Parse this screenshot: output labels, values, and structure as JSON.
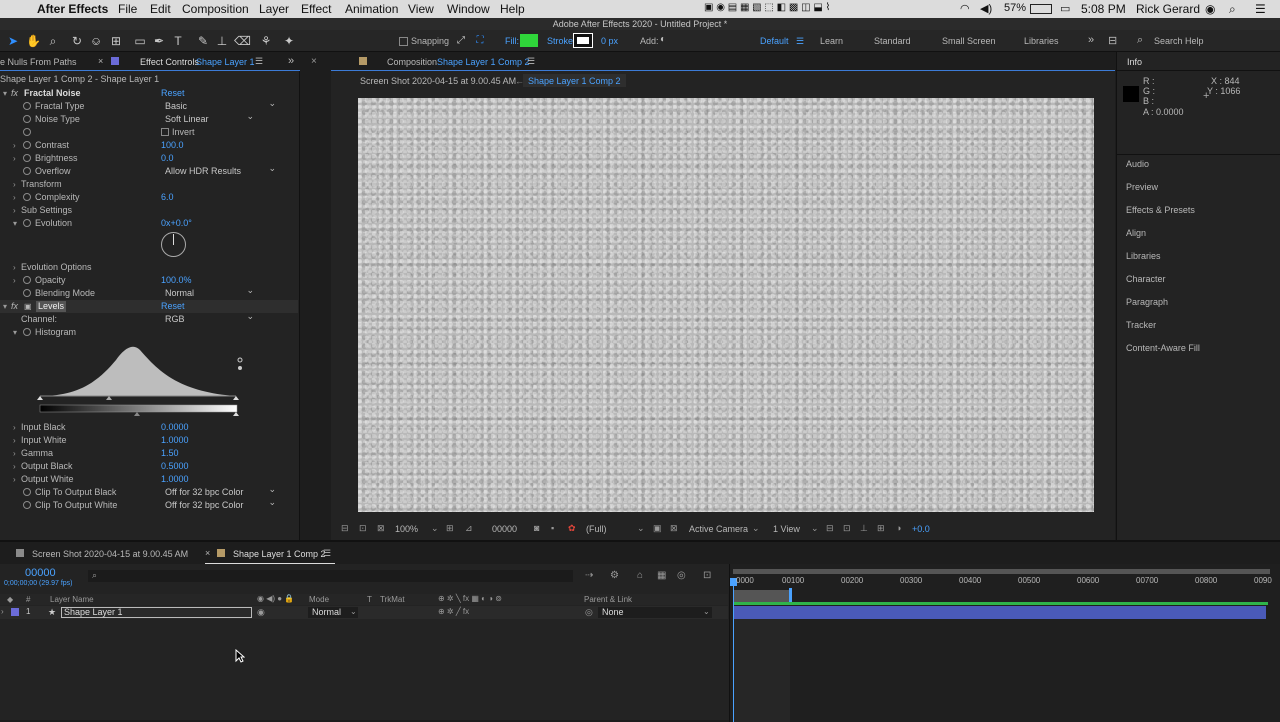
{
  "menubar": {
    "app": "After Effects",
    "items": [
      "File",
      "Edit",
      "Composition",
      "Layer",
      "Effect",
      "Animation",
      "View",
      "Window",
      "Help"
    ],
    "battery": "57%",
    "time": "5:08 PM",
    "user": "Rick Gerard"
  },
  "window_title": "Adobe After Effects 2020 - Untitled Project *",
  "toolbar": {
    "snapping_label": "Snapping",
    "fill_label": "Fill:",
    "stroke_label": "Stroke:",
    "stroke_width": "0 px",
    "add_label": "Add:",
    "fill_color": "#2fd53a",
    "workspaces": [
      "Default",
      "Learn",
      "Standard",
      "Small Screen",
      "Libraries"
    ],
    "search_help": "Search Help"
  },
  "left_panel": {
    "tab_nulls": "e Nulls From Paths",
    "tab_effect_controls": "Effect Controls",
    "tab_effect_layer": "Shape Layer 1",
    "breadcrumb": "Shape Layer 1 Comp 2 - Shape Layer 1",
    "fractal": {
      "name": "Fractal Noise",
      "reset": "Reset",
      "fractal_type_label": "Fractal Type",
      "fractal_type": "Basic",
      "noise_type_label": "Noise Type",
      "noise_type": "Soft Linear",
      "invert_label": "Invert",
      "contrast_label": "Contrast",
      "contrast": "100.0",
      "brightness_label": "Brightness",
      "brightness": "0.0",
      "overflow_label": "Overflow",
      "overflow": "Allow HDR Results",
      "transform_label": "Transform",
      "complexity_label": "Complexity",
      "complexity": "6.0",
      "sub_settings_label": "Sub Settings",
      "evolution_label": "Evolution",
      "evolution": "0x+0.0°",
      "evolution_options_label": "Evolution Options",
      "opacity_label": "Opacity",
      "opacity": "100.0%",
      "blending_label": "Blending Mode",
      "blending": "Normal"
    },
    "levels": {
      "name": "Levels",
      "reset": "Reset",
      "channel_label": "Channel:",
      "channel": "RGB",
      "histogram_label": "Histogram",
      "input_black_label": "Input Black",
      "input_black": "0.0000",
      "input_white_label": "Input White",
      "input_white": "1.0000",
      "gamma_label": "Gamma",
      "gamma": "1.50",
      "output_black_label": "Output Black",
      "output_black": "0.5000",
      "output_white_label": "Output White",
      "output_white": "1.0000",
      "clip_black_label": "Clip To Output Black",
      "clip_black": "Off for 32 bpc Color",
      "clip_white_label": "Clip To Output White",
      "clip_white": "Off for 32 bpc Color"
    }
  },
  "comp_panel": {
    "tab_prefix": "Composition",
    "tab_name": "Shape Layer 1 Comp 2",
    "crumb1": "Screen Shot 2020-04-15 at 9.00.45 AM",
    "crumb2": "Shape Layer 1 Comp 2",
    "zoom": "100%",
    "timecode": "00000",
    "resolution": "(Full)",
    "camera": "Active Camera",
    "views": "1 View",
    "exposure": "+0.0"
  },
  "info_panel": {
    "title": "Info",
    "r": "R :",
    "g": "G :",
    "b": "B :",
    "a": "A :  0.0000",
    "x": "X : 844",
    "y": "Y : 1066",
    "links": [
      "Audio",
      "Preview",
      "Effects & Presets",
      "Align",
      "Libraries",
      "Character",
      "Paragraph",
      "Tracker",
      "Content-Aware Fill"
    ]
  },
  "timeline": {
    "tab1": "Screen Shot 2020-04-15 at 9.00.45 AM",
    "tab2": "Shape Layer 1 Comp 2",
    "current_time": "00000",
    "fps": "0;00;00;00 (29.97 fps)",
    "col_layer_name": "Layer Name",
    "col_mode": "Mode",
    "col_t": "T",
    "col_trkmat": "TrkMat",
    "col_parent": "Parent & Link",
    "col_num": "#",
    "layer_index": "1",
    "layer_name": "Shape Layer 1",
    "layer_mode": "Normal",
    "layer_parent": "None",
    "ruler": [
      "0000",
      "00100",
      "00200",
      "00300",
      "00400",
      "00500",
      "00600",
      "00700",
      "00800",
      "0090"
    ]
  }
}
